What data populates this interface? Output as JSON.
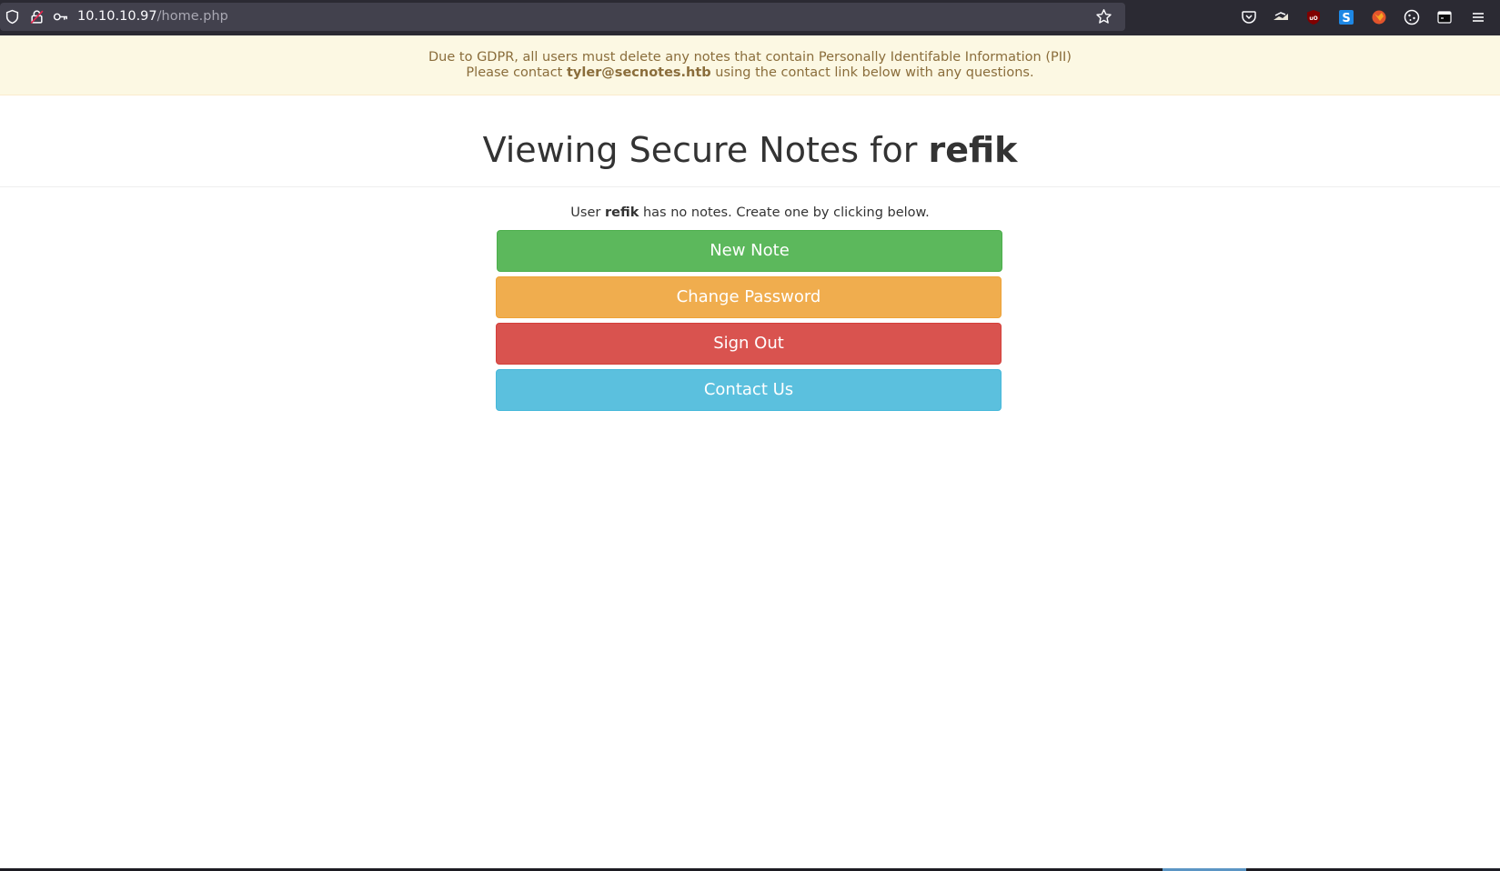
{
  "browser": {
    "url_host": "10.10.10.97",
    "url_path": "/home.php",
    "icons": [
      "shield-icon",
      "lock-icon",
      "key-icon",
      "bookmark-star-icon",
      "pocket-icon",
      "extension-icon",
      "ublock-icon",
      "s-extension-icon",
      "fox-extension-icon",
      "cookie-icon",
      "terminal-icon",
      "menu-icon"
    ]
  },
  "alert": {
    "line1": "Due to GDPR, all users must delete any notes that contain Personally Identifable Information (PII)",
    "line2_prefix": "Please contact ",
    "email": "tyler@secnotes.htb",
    "line2_suffix": " using the contact link below with any questions."
  },
  "heading": {
    "prefix": "Viewing Secure Notes for ",
    "username": "refik"
  },
  "info": {
    "prefix": "User ",
    "username": "refik",
    "suffix": " has no notes. Create one by clicking below."
  },
  "buttons": {
    "new_note": "New Note",
    "change_password": "Change Password",
    "sign_out": "Sign Out",
    "contact_us": "Contact Us"
  },
  "colors": {
    "green": "#5cb85c",
    "orange": "#f0ad4e",
    "red": "#d9534f",
    "blue": "#5bc0de",
    "alert_bg": "#fcf8e3",
    "alert_text": "#8a6d3b"
  }
}
